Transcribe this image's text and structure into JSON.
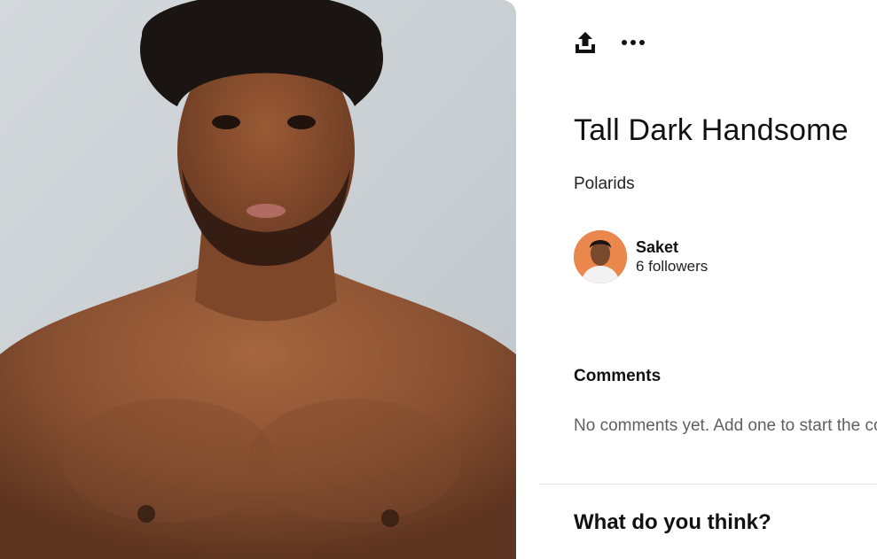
{
  "pin": {
    "image_alt": "Shirtless man with curly hair against a light grey background",
    "title": "Tall Dark Handsome",
    "description": "Polarids"
  },
  "toolbar": {
    "share_icon": "upload-share-icon",
    "more_icon": "more-options-icon"
  },
  "creator": {
    "name": "Saket",
    "followers": "6 followers",
    "avatar_bg": "#e9874c"
  },
  "comments": {
    "heading": "Comments",
    "empty_text": "No comments yet. Add one to start the conversation."
  },
  "composer": {
    "prompt": "What do you think?"
  }
}
